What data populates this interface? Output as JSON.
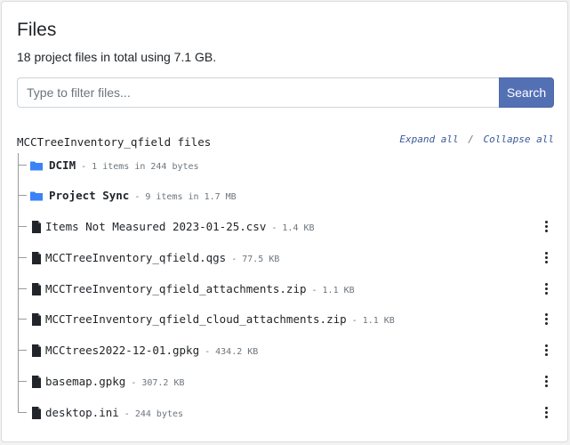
{
  "header": {
    "title": "Files",
    "subtitle": "18 project files in total using 7.1 GB."
  },
  "search": {
    "placeholder": "Type to filter files...",
    "button_label": "Search"
  },
  "tree": {
    "title": "MCCTreeInventory_qfield files",
    "expand_all": "Expand all",
    "separator": "/",
    "collapse_all": "Collapse all",
    "items": [
      {
        "type": "folder",
        "name": "DCIM",
        "meta": "- 1 items in 244 bytes"
      },
      {
        "type": "folder",
        "name": "Project Sync",
        "meta": "- 9 items in 1.7 MB"
      },
      {
        "type": "file",
        "name": "Items Not Measured 2023-01-25.csv",
        "meta": "- 1.4 KB"
      },
      {
        "type": "file",
        "name": "MCCTreeInventory_qfield.qgs",
        "meta": "- 77.5 KB"
      },
      {
        "type": "file",
        "name": "MCCTreeInventory_qfield_attachments.zip",
        "meta": "- 1.1 KB"
      },
      {
        "type": "file",
        "name": "MCCTreeInventory_qfield_cloud_attachments.zip",
        "meta": "- 1.1 KB"
      },
      {
        "type": "file",
        "name": "MCCtrees2022-12-01.gpkg",
        "meta": "- 434.2 KB"
      },
      {
        "type": "file",
        "name": "basemap.gpkg",
        "meta": "- 307.2 KB"
      },
      {
        "type": "file",
        "name": "desktop.ini",
        "meta": "- 244 bytes"
      }
    ]
  },
  "colors": {
    "accent": "#5470b5",
    "folder": "#3b82f6",
    "link": "#3a5a9a"
  }
}
